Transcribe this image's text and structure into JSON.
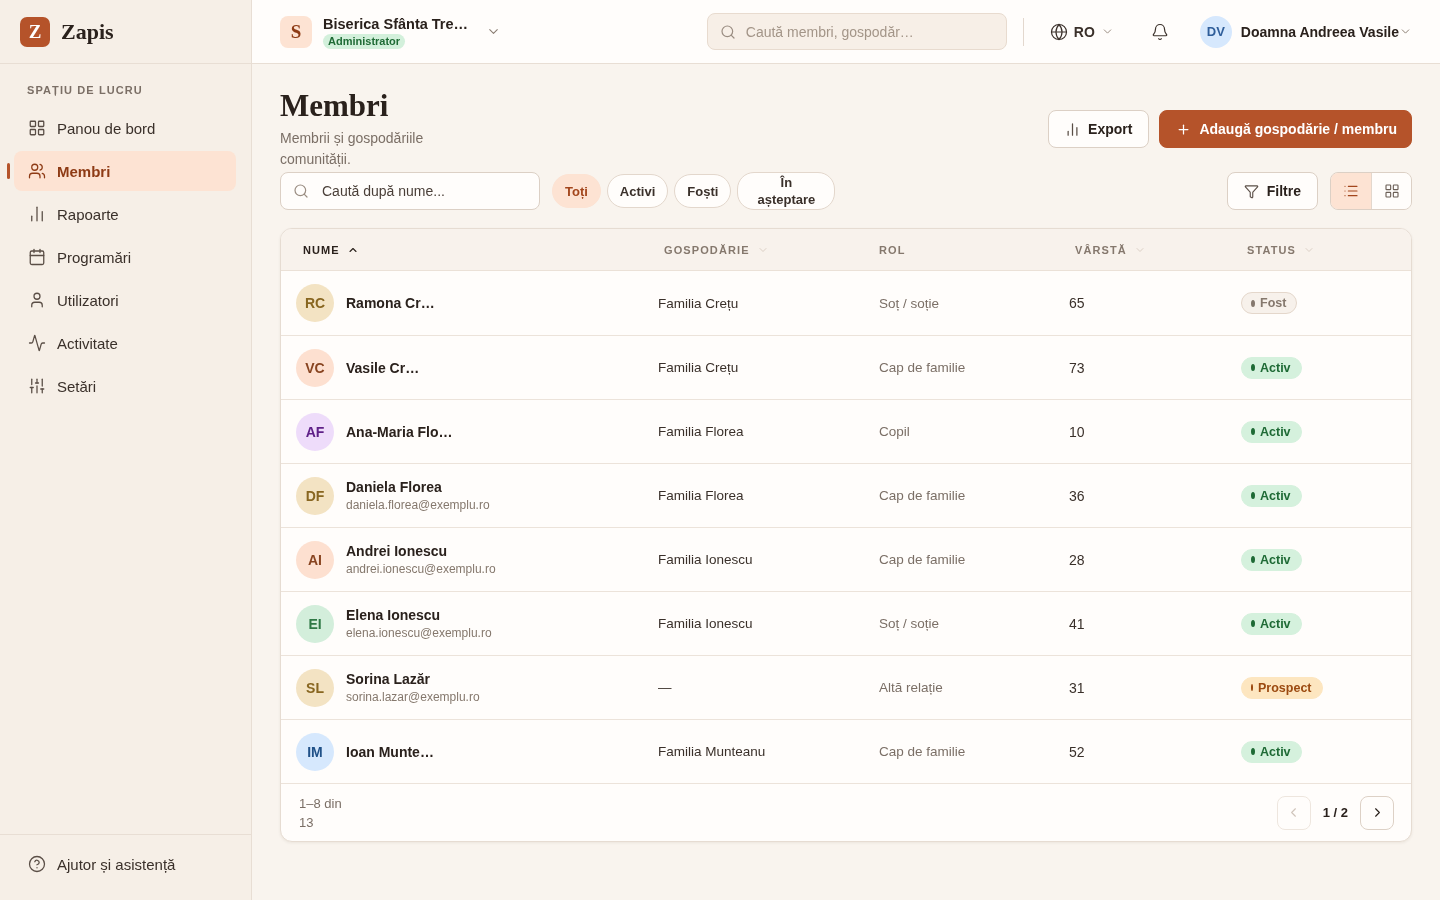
{
  "sidebar": {
    "brand": {
      "logo": "Z",
      "name": "Zapis"
    },
    "section_label": "SPAȚIU DE LUCRU",
    "items": [
      {
        "label": "Panou de bord",
        "selected": false
      },
      {
        "label": "Membri",
        "selected": true
      },
      {
        "label": "Rapoarte",
        "selected": false
      },
      {
        "label": "Programări",
        "selected": false
      },
      {
        "label": "Utilizatori",
        "selected": false
      },
      {
        "label": "Activitate",
        "selected": false
      },
      {
        "label": "Setări",
        "selected": false
      }
    ],
    "help_link": "Ajutor și asistență"
  },
  "top_bar": {
    "organization": {
      "initial": "S",
      "name": "Biserica Sfânta Tre…",
      "role": "Administrator"
    },
    "search": {
      "placeholder": "Caută membri, gospodăr…"
    },
    "language": "RO",
    "user": {
      "initials": "DV",
      "name": "Doamna Andreea Vasile"
    }
  },
  "page": {
    "title": "Membri",
    "subtitle": "Membrii și gospodăriile comunității."
  },
  "actions": [
    {
      "label": "Export",
      "kind": "secondary"
    },
    {
      "label": "Adaugă gospodărie / membru",
      "kind": "primary"
    }
  ],
  "filters": {
    "search": {
      "placeholder": "Caută după nume..."
    },
    "chips": [
      {
        "label": "Toți",
        "selected": true
      },
      {
        "label": "Activi",
        "selected": false
      },
      {
        "label": "Foști",
        "selected": false
      },
      {
        "label": "În așteptare",
        "selected": false
      }
    ],
    "filter_button": "Filtre",
    "views": [
      {
        "kind": "list",
        "selected": true
      },
      {
        "kind": "grid",
        "selected": false
      }
    ]
  },
  "table": {
    "columns": [
      {
        "label": "NUME",
        "sortable": true,
        "sorted": true
      },
      {
        "label": "GOSPODĂRIE",
        "sortable": true,
        "sorted": false
      },
      {
        "label": "ROL",
        "sortable": false,
        "sorted": false
      },
      {
        "label": "VÂRSTĂ",
        "sortable": true,
        "sorted": false
      },
      {
        "label": "STATUS",
        "sortable": true,
        "sorted": false
      }
    ],
    "rows": [
      {
        "initials": "RC",
        "color": "#f3e3c3",
        "name": "Ramona Cr…",
        "household": "Familia Crețu",
        "role": "Soț / soție",
        "age": "65",
        "status": {
          "label": "Fost",
          "kind": "former"
        }
      },
      {
        "initials": "VC",
        "color": "#fde0d0",
        "name": "Vasile Cr…",
        "household": "Familia Crețu",
        "role": "Cap de familie",
        "age": "73",
        "status": {
          "label": "Activ",
          "kind": "active"
        }
      },
      {
        "initials": "AF",
        "color": "#eedcfa",
        "name": "Ana-Maria Flo…",
        "household": "Familia Florea",
        "role": "Copil",
        "age": "10",
        "status": {
          "label": "Activ",
          "kind": "active"
        }
      },
      {
        "initials": "DF",
        "color": "#f3e3c3",
        "name": "Daniela Florea",
        "email": "daniela.florea@exemplu.ro",
        "household": "Familia Florea",
        "role": "Cap de familie",
        "age": "36",
        "status": {
          "label": "Activ",
          "kind": "active"
        }
      },
      {
        "initials": "AI",
        "color": "#fde0d0",
        "name": "Andrei Ionescu",
        "email": "andrei.ionescu@exemplu.ro",
        "household": "Familia Ionescu",
        "role": "Cap de familie",
        "age": "28",
        "status": {
          "label": "Activ",
          "kind": "active"
        }
      },
      {
        "initials": "EI",
        "color": "#d3eedb",
        "name": "Elena Ionescu",
        "email": "elena.ionescu@exemplu.ro",
        "household": "Familia Ionescu",
        "role": "Soț / soție",
        "age": "41",
        "status": {
          "label": "Activ",
          "kind": "active"
        }
      },
      {
        "initials": "SL",
        "color": "#f3e3c3",
        "name": "Sorina Lazăr",
        "email": "sorina.lazar@exemplu.ro",
        "household": "—",
        "role": "Altă relație",
        "age": "31",
        "status": {
          "label": "Prospect",
          "kind": "prospect"
        }
      },
      {
        "initials": "IM",
        "color": "#d6e8fd",
        "name": "Ioan Munte…",
        "household": "Familia Munteanu",
        "role": "Cap de familie",
        "age": "52",
        "status": {
          "label": "Activ",
          "kind": "active"
        }
      }
    ],
    "footer": {
      "range": "1–8 din 13",
      "previous_disabled": true,
      "page": "1 / 2",
      "next_disabled": false
    }
  }
}
